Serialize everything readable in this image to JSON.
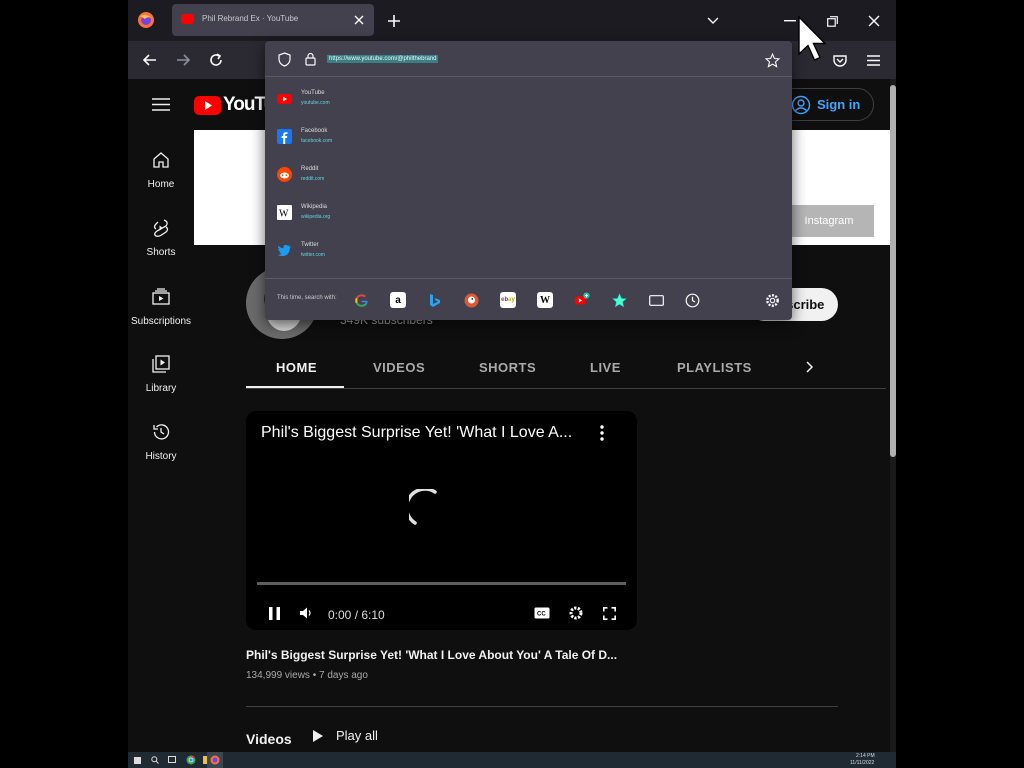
{
  "browser": {
    "tab_title": "Phil Rebrand Ex · YouTube",
    "url": "https://www.youtube.com/@philthebrand"
  },
  "url_dropdown": {
    "suggestions": [
      {
        "title": "YouTube",
        "url": "youtube.com",
        "icon": "youtube-icon",
        "color": "#ff0000"
      },
      {
        "title": "Facebook",
        "url": "facebook.com",
        "icon": "facebook-icon",
        "color": "#1877f2"
      },
      {
        "title": "Reddit",
        "url": "reddit.com",
        "icon": "reddit-icon",
        "color": "#ff4500"
      },
      {
        "title": "Wikipedia",
        "url": "wikipedia.org",
        "icon": "wikipedia-icon",
        "color": "#ffffff"
      },
      {
        "title": "Twitter",
        "url": "twitter.com",
        "icon": "twitter-icon",
        "color": "#1d9bf0"
      }
    ],
    "search_label": "This time, search with:"
  },
  "youtube": {
    "logo_text": "YouTube",
    "sign_in": "Sign in",
    "sidebar": [
      {
        "label": "Home"
      },
      {
        "label": "Shorts"
      },
      {
        "label": "Subscriptions"
      },
      {
        "label": "Library"
      },
      {
        "label": "History"
      }
    ],
    "banner_link": "Instagram",
    "subscribers": "349K subscribers",
    "subscribe_label": "Subscribe",
    "tabs": [
      "HOME",
      "VIDEOS",
      "SHORTS",
      "LIVE",
      "PLAYLISTS"
    ],
    "player": {
      "title": "Phil's Biggest Surprise Yet! 'What I Love A...",
      "time": "0:00 / 6:10"
    },
    "video": {
      "title": "Phil's Biggest Surprise Yet! 'What I Love About You' A Tale Of D...",
      "meta": "134,999 views • 7 days ago"
    },
    "section_title": "Videos",
    "play_all": "Play all"
  },
  "taskbar": {
    "time": "2:14 PM",
    "date": "11/11/2022"
  }
}
